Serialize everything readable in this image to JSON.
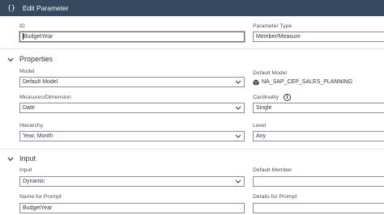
{
  "dialog": {
    "title": "Edit Parameter",
    "icon": "braces-icon"
  },
  "general": {
    "id_label": "ID",
    "id_value": "BudgetYear",
    "param_type_label": "Parameter Type",
    "param_type_value": "Member/Measure"
  },
  "properties": {
    "section_title": "Properties",
    "model_label": "Model",
    "model_value": "Default Model",
    "default_model_label": "Default Model",
    "default_model_value": "NA_SAP_CEP_SALES_PLANNING",
    "measures_label": "Measures/Dimension",
    "measures_value": "Date",
    "cardinality_label": "Cardinality",
    "cardinality_value": "Single",
    "hierarchy_label": "Hierarchy",
    "hierarchy_value": "Year, Month",
    "level_label": "Level",
    "level_value": "Any"
  },
  "input": {
    "section_title": "Input",
    "input_label": "Input",
    "input_value": "Dynamic",
    "default_member_label": "Default Member",
    "default_member_value": "",
    "name_prompt_label": "Name for Prompt",
    "name_prompt_value": "BudgetYear",
    "details_prompt_label": "Details for Prompt",
    "details_prompt_value": ""
  }
}
